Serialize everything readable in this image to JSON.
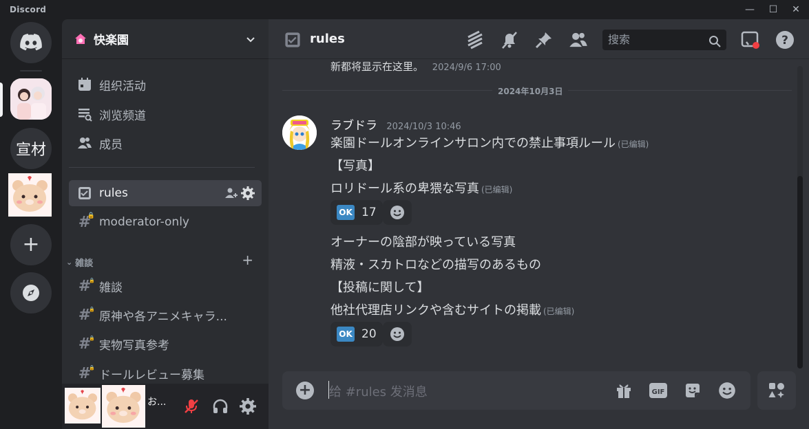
{
  "app": {
    "title": "Discord"
  },
  "window": {
    "minimize": "—",
    "maximize": "☐",
    "close": "✕"
  },
  "rail": {
    "servers": [
      {
        "name": "home",
        "icon": "discord-icon"
      },
      {
        "name": "server-photo-avatar",
        "icon": "image"
      },
      {
        "name": "server-xuancai",
        "label": "宣材"
      },
      {
        "name": "server-bear-avatar",
        "icon": "image"
      },
      {
        "name": "add-server",
        "icon": "plus-icon"
      },
      {
        "name": "explore",
        "icon": "compass-icon"
      }
    ]
  },
  "guild": {
    "name": "快楽園"
  },
  "sidebar": {
    "nav": [
      {
        "label": "组织活动",
        "icon": "calendar-icon"
      },
      {
        "label": "浏览频道",
        "icon": "channel-browse-icon"
      },
      {
        "label": "成员",
        "icon": "members-icon"
      }
    ],
    "channels_top": [
      {
        "label": "rules",
        "icon": "rules-icon",
        "active": true
      },
      {
        "label": "moderator-only",
        "icon": "locked-hash-icon"
      }
    ],
    "category": "雑談",
    "channels": [
      {
        "label": "雑談"
      },
      {
        "label": "原神や各アニメキャラ..."
      },
      {
        "label": "実物写真参考"
      },
      {
        "label": "ドールレビュー募集"
      }
    ]
  },
  "user": {
    "name": "お..."
  },
  "topbar": {
    "channel": "rules",
    "search_placeholder": "搜索"
  },
  "messages": {
    "previous_tail": {
      "text": "新都将显示在这里。",
      "time": "2024/9/6 17:00"
    },
    "date_divider": "2024年10月3日",
    "author": "ラブドラ",
    "time": "2024/10/3 10:46",
    "lines": [
      {
        "text": "楽園ドールオンラインサロン内での禁止事項ルール",
        "edited": "(已编辑)"
      },
      {
        "text": "【写真】",
        "edited": ""
      },
      {
        "text": "ロリドール系の卑猥な写真",
        "edited": "(已编辑)"
      },
      {
        "text": "オーナーの陰部が映っている写真",
        "edited": ""
      },
      {
        "text": "精液・スカトロなどの描写のあるもの",
        "edited": ""
      },
      {
        "text": "【投稿に関して】",
        "edited": ""
      },
      {
        "text": "他社代理店リンクや含むサイトの掲載",
        "edited": "(已编辑)"
      }
    ],
    "reactions": [
      {
        "emoji": "OK",
        "count": "17"
      },
      {
        "emoji": "OK",
        "count": "20"
      }
    ]
  },
  "composer": {
    "placeholder": "给 #rules 发消息"
  },
  "colors": {
    "accent": "#5865f2",
    "ok_emoji": "#3b88c3",
    "mute_red": "#f23f43"
  }
}
